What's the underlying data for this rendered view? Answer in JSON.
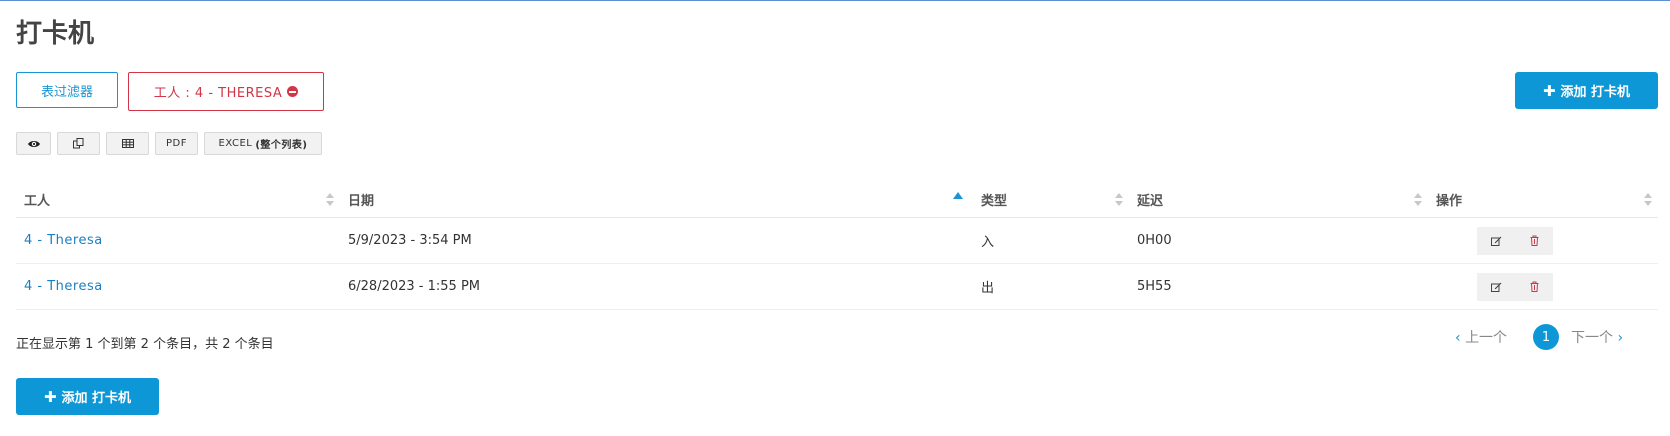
{
  "page": {
    "title": "打卡机"
  },
  "filters": {
    "table_filter_label": "表过滤器",
    "active_chip_label": "工人 : 4 - THERESA"
  },
  "actions": {
    "add_label": "添加 打卡机"
  },
  "toolbar": {
    "view_icon": "eye-icon",
    "copy_icon": "copy-icon",
    "csv_icon": "table-icon",
    "pdf_label": "PDF",
    "excel_label": "EXCEL",
    "excel_note": "(整个列表)"
  },
  "table": {
    "columns": [
      "工人",
      "日期",
      "类型",
      "延迟",
      "操作"
    ],
    "sorted_column": "日期",
    "sort_direction": "asc",
    "rows": [
      {
        "worker": "4 - Theresa",
        "date": "5/9/2023 - 3:54 PM",
        "type": "入",
        "delay": "0H00"
      },
      {
        "worker": "4 - Theresa",
        "date": "6/28/2023 - 1:55 PM",
        "type": "出",
        "delay": "5H55"
      }
    ],
    "row_action_icons": [
      "edit-icon",
      "trash-icon"
    ]
  },
  "summary": {
    "text": "正在显示第 1 个到第 2 个条目，共 2 个条目"
  },
  "pagination": {
    "prev_label": "上一个",
    "current_page": "1",
    "next_label": "下一个"
  },
  "colors": {
    "primary": "#0e97d6",
    "danger": "#d23545",
    "link": "#1a7fc1"
  }
}
